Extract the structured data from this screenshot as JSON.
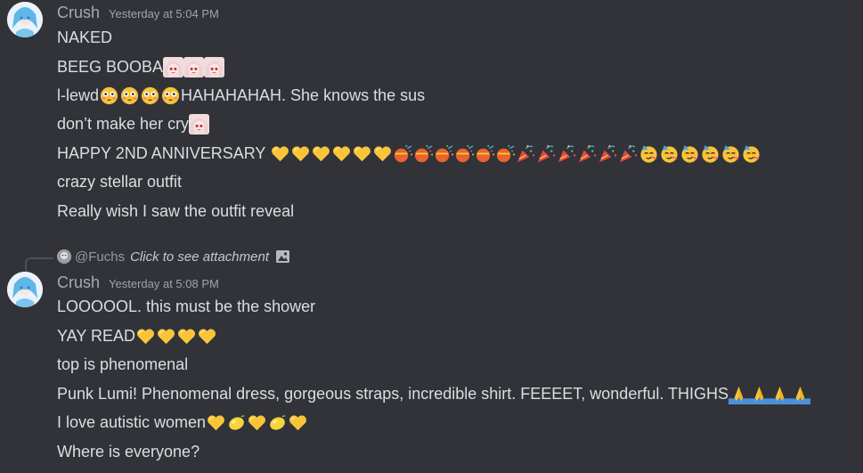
{
  "messages": [
    {
      "username": "Crush",
      "timestamp": "Yesterday at 5:04 PM",
      "lines": [
        {
          "text": "NAKED",
          "emojis": []
        },
        {
          "text": "BEEG BOOBA",
          "emojis": [
            "anime-girl-emoji",
            "anime-girl-emoji",
            "anime-girl-emoji"
          ]
        },
        {
          "text": "l-lewd",
          "emojis": [
            "flushed-emoji",
            "flushed-emoji",
            "flushed-emoji",
            "flushed-emoji"
          ],
          "after": "HAHAHAHAH. She knows the sus"
        },
        {
          "text": "don’t make her cry",
          "emojis": [
            "anime-girl-emoji"
          ]
        },
        {
          "text": "HAPPY 2ND ANNIVERSARY ",
          "emojis": [
            "yellow-heart-emoji",
            "yellow-heart-emoji",
            "yellow-heart-emoji",
            "yellow-heart-emoji",
            "yellow-heart-emoji",
            "yellow-heart-emoji",
            "confetti-ball-emoji",
            "confetti-ball-emoji",
            "confetti-ball-emoji",
            "confetti-ball-emoji",
            "confetti-ball-emoji",
            "confetti-ball-emoji",
            "party-popper-emoji",
            "party-popper-emoji",
            "party-popper-emoji",
            "party-popper-emoji",
            "party-popper-emoji",
            "party-popper-emoji",
            "partying-face-emoji",
            "partying-face-emoji",
            "partying-face-emoji",
            "partying-face-emoji",
            "partying-face-emoji",
            "partying-face-emoji"
          ]
        },
        {
          "text": "crazy stellar outfit",
          "emojis": []
        },
        {
          "text": "Really wish I saw the outfit reveal",
          "emojis": []
        }
      ]
    },
    {
      "reply": {
        "mention": "@Fuchs",
        "content": "Click to see attachment"
      },
      "username": "Crush",
      "timestamp": "Yesterday at 5:08 PM",
      "lines": [
        {
          "text": "LOOOOOL. this must be the shower",
          "emojis": []
        },
        {
          "text": "YAY READ",
          "emojis": [
            "yellow-heart-emoji",
            "yellow-heart-emoji",
            "yellow-heart-emoji",
            "yellow-heart-emoji"
          ]
        },
        {
          "text": "top is phenomenal",
          "emojis": []
        },
        {
          "text": "Punk Lumi! Phenomenal dress, gorgeous straps, incredible shirt. FEEEET, wonderful. THIGHS",
          "emojis": [
            "folded-hands-emoji",
            "folded-hands-emoji",
            "folded-hands-emoji",
            "folded-hands-emoji"
          ]
        },
        {
          "text": "I love autistic women",
          "emojis": [
            "yellow-heart-emoji",
            "lemon-emoji",
            "yellow-heart-emoji",
            "lemon-emoji",
            "yellow-heart-emoji"
          ]
        },
        {
          "text": "Where is everyone?",
          "emojis": []
        }
      ]
    }
  ],
  "colors": {
    "background": "#313338",
    "username": "#a3aab5",
    "timestamp": "#a0a4ab",
    "text": "#dbdee1"
  }
}
